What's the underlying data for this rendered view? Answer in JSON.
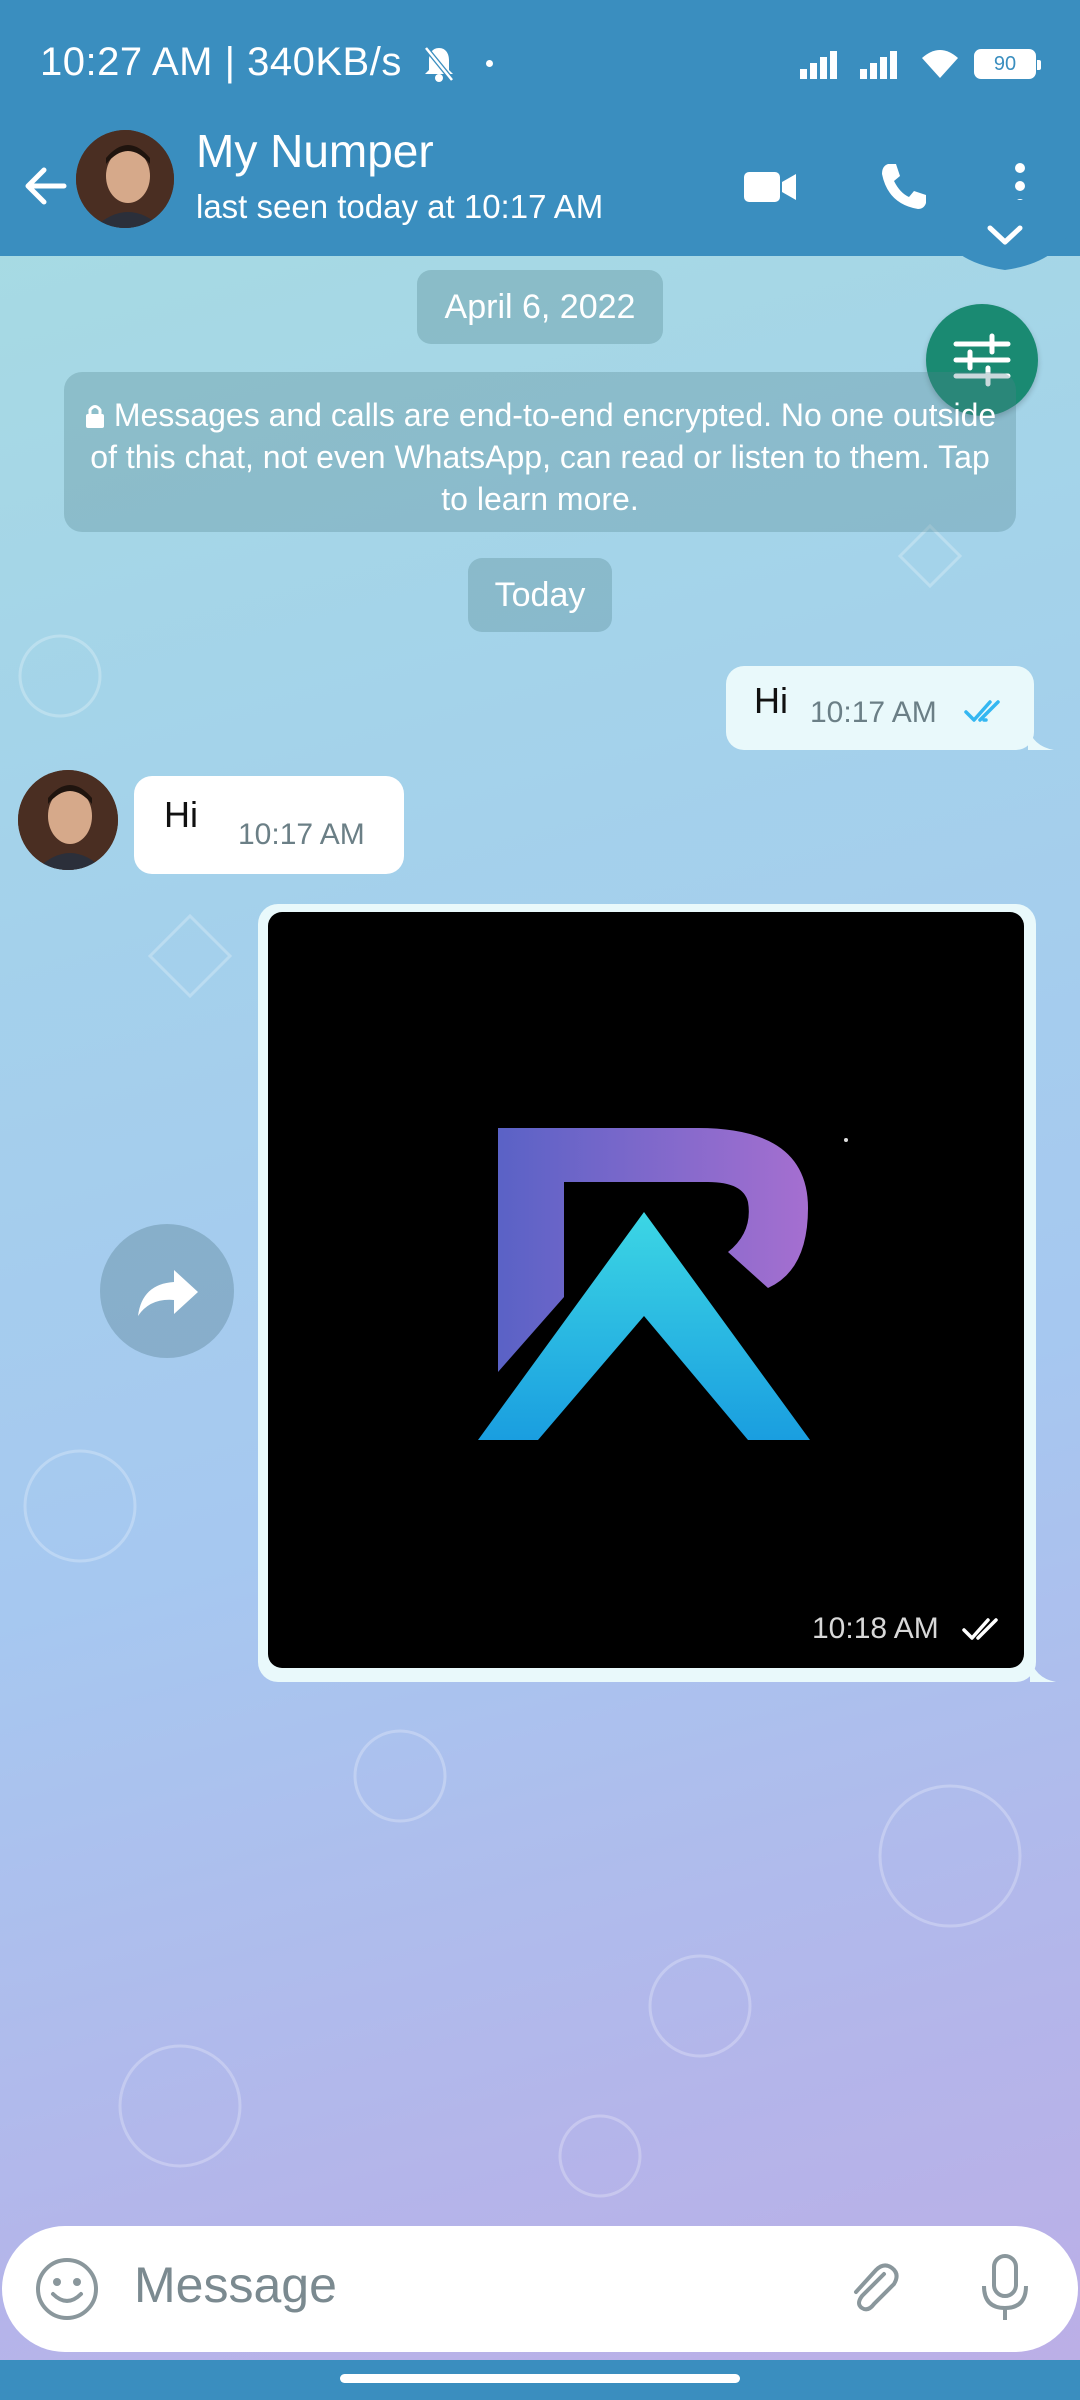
{
  "status": {
    "time_speed": "10:27 AM | 340KB/s",
    "battery": "90"
  },
  "contact": {
    "name": "My Numper",
    "last_seen": "last seen today at 10:17 AM"
  },
  "chat": {
    "date_label": "April 6, 2022",
    "encryption_notice": "Messages and calls are end-to-end encrypted. No one outside of this chat, not even WhatsApp, can read or listen to them. Tap to learn more.",
    "today_label": "Today",
    "messages": [
      {
        "direction": "outgoing",
        "text": "Hi",
        "time": "10:17 AM",
        "status": "read"
      },
      {
        "direction": "incoming",
        "text": "Hi",
        "time": "10:17 AM"
      },
      {
        "direction": "outgoing",
        "type": "image",
        "time": "10:18 AM",
        "status": "delivered"
      }
    ]
  },
  "composer": {
    "placeholder": "Message"
  },
  "colors": {
    "header": "#3a8ebf",
    "accent_green": "#1a8a72",
    "read_ticks": "#34b7f1"
  },
  "icons": [
    "back-arrow-icon",
    "video-call-icon",
    "phone-icon",
    "more-vert-icon",
    "chevron-down-icon",
    "tune-icon",
    "forward-icon",
    "emoji-icon",
    "attach-icon",
    "mic-icon",
    "lock-icon"
  ]
}
